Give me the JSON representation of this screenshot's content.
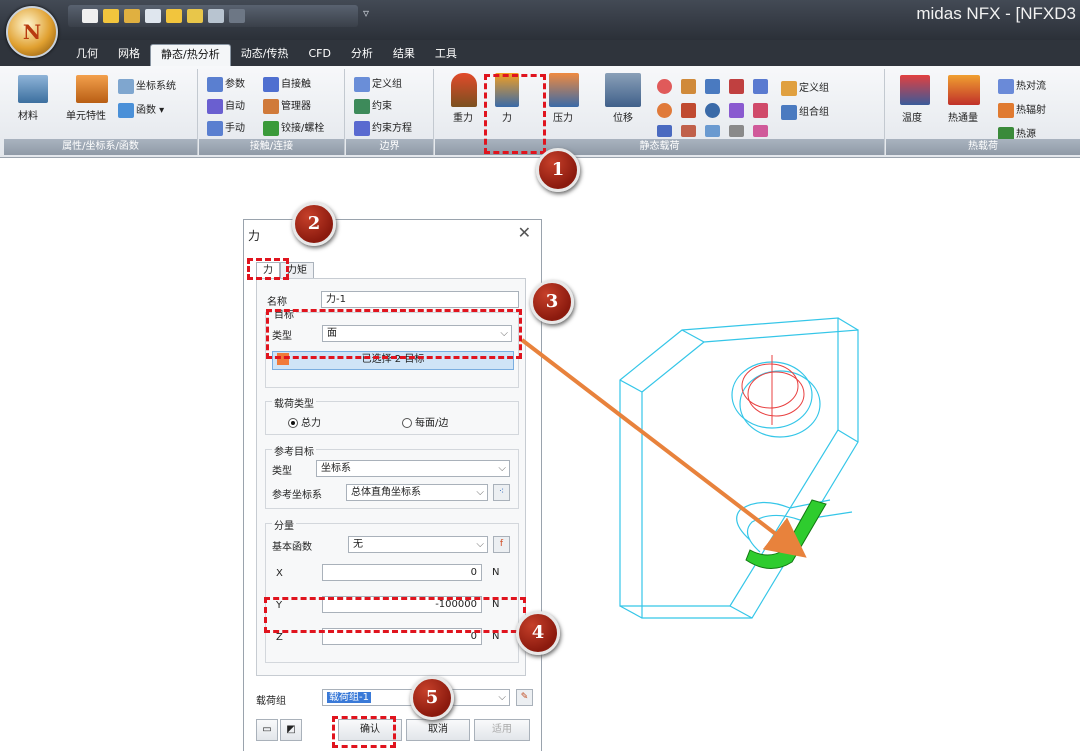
{
  "app": {
    "logo_letter": "N",
    "title": "midas NFX - [NFXD3",
    "qat_more": "▿"
  },
  "ribbon": {
    "tabs": [
      "几何",
      "网格",
      "静态/热分析",
      "动态/传热",
      "CFD",
      "分析",
      "结果",
      "工具"
    ],
    "active_tab": "静态/热分析",
    "groups": {
      "props": {
        "label": "属性/坐标系/函数",
        "material": "材料",
        "element_prop": "单元特性",
        "coord": "坐标系统",
        "func": "函数"
      },
      "contact": {
        "label": "接触/连接",
        "param": "参数",
        "auto_contact": "自接触",
        "auto": "自动",
        "manager": "管理器",
        "manual": "手动",
        "weld": "铰接/螺栓"
      },
      "boundary": {
        "label": "边界",
        "define_group": "定义组",
        "constraint": "约束",
        "constraint_eq": "约束方程"
      },
      "static_load": {
        "label": "静态载荷",
        "gravity": "重力",
        "force": "力",
        "pressure": "压力",
        "displacement": "位移",
        "define_group": "定义组",
        "combine_group": "组合组"
      },
      "thermal_load": {
        "label": "热载荷",
        "temperature": "温度",
        "heat_flux": "热通量",
        "convection": "热对流",
        "radiation": "热辐射",
        "heat_source": "热源"
      }
    }
  },
  "dialog": {
    "title": "力",
    "close": "✕",
    "tabs": [
      "力",
      "力矩"
    ],
    "name_label": "名称",
    "name_value": "力-1",
    "target_section": "目标",
    "type_label": "类型",
    "type_value": "面",
    "selected_text": "已选择 2 目标",
    "load_type_section": "载荷类型",
    "radio_total": "总力",
    "radio_per": "每面/边",
    "ref_section": "参考目标",
    "ref_type_label": "类型",
    "ref_type_value": "坐标系",
    "ref_cs_label": "参考坐标系",
    "ref_cs_value": "总体直角坐标系",
    "component_section": "分量",
    "basefunc_label": "基本函数",
    "basefunc_value": "无",
    "x_label": "X",
    "x_value": "0",
    "y_label": "Y",
    "y_value": "-100000",
    "z_label": "Z",
    "z_value": "0",
    "unit": "N",
    "load_group_label": "载荷组",
    "load_group_value": "载荷组-1",
    "ok": "确认",
    "cancel": "取消",
    "apply": "适用"
  },
  "callouts": [
    "1",
    "2",
    "3",
    "4",
    "5"
  ],
  "colors": {
    "callout": "#a82a18",
    "dash": "#e0141e",
    "arrow": "#e8823c",
    "wire": "#35c6e8",
    "face": "#2ecc2e",
    "hole": "#e84040"
  }
}
